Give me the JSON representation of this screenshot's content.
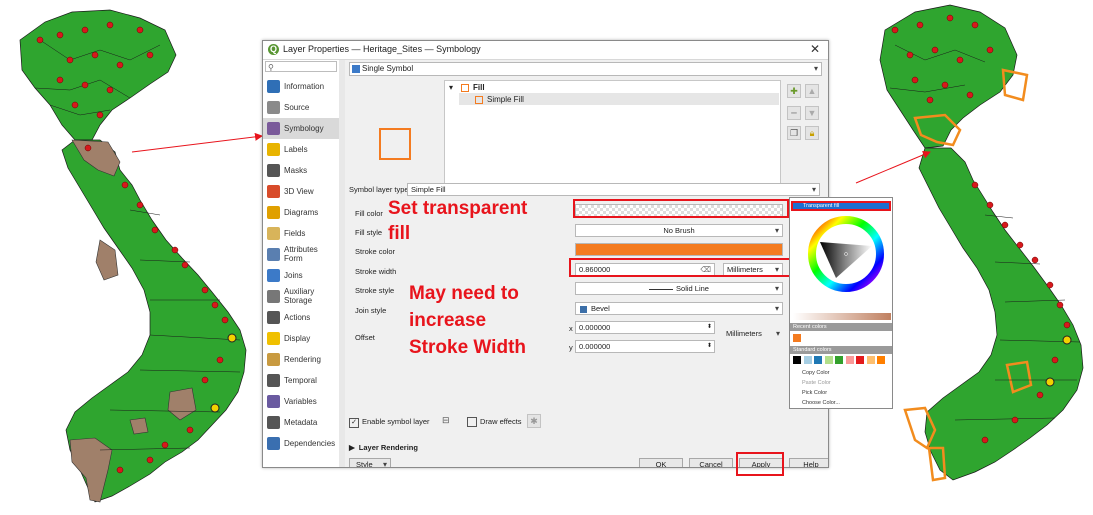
{
  "window": {
    "title": "Layer Properties — Heritage_Sites — Symbology",
    "app_icon": "qgis-icon",
    "close_glyph": "✕"
  },
  "sidebar": {
    "search_placeholder": "",
    "items": [
      {
        "label": "Information",
        "icon": "information-icon",
        "color": "#2f6fb6"
      },
      {
        "label": "Source",
        "icon": "source-icon",
        "color": "#8a8a8a"
      },
      {
        "label": "Symbology",
        "icon": "symbology-icon",
        "color": "#7a5a9a"
      },
      {
        "label": "Labels",
        "icon": "labels-icon",
        "color": "#e8b400"
      },
      {
        "label": "Masks",
        "icon": "masks-icon",
        "color": "#555555"
      },
      {
        "label": "3D View",
        "icon": "3d-view-icon",
        "color": "#d84b2a"
      },
      {
        "label": "Diagrams",
        "icon": "diagrams-icon",
        "color": "#e0a000"
      },
      {
        "label": "Fields",
        "icon": "fields-icon",
        "color": "#d8b45a"
      },
      {
        "label": "Attributes Form",
        "icon": "attributes-form-icon",
        "color": "#5a7fb0"
      },
      {
        "label": "Joins",
        "icon": "joins-icon",
        "color": "#3c7ac8"
      },
      {
        "label": "Auxiliary Storage",
        "icon": "auxiliary-storage-icon",
        "color": "#777777"
      },
      {
        "label": "Actions",
        "icon": "actions-icon",
        "color": "#555555"
      },
      {
        "label": "Display",
        "icon": "display-icon",
        "color": "#f0c000"
      },
      {
        "label": "Rendering",
        "icon": "rendering-icon",
        "color": "#c89a40"
      },
      {
        "label": "Temporal",
        "icon": "temporal-icon",
        "color": "#555555"
      },
      {
        "label": "Variables",
        "icon": "variables-icon",
        "color": "#6a5aa0"
      },
      {
        "label": "Metadata",
        "icon": "metadata-icon",
        "color": "#555555"
      },
      {
        "label": "Dependencies",
        "icon": "dependencies-icon",
        "color": "#3a6fb0"
      }
    ],
    "selected": "Symbology"
  },
  "renderer": {
    "value": "Single Symbol",
    "icon": "single-symbol-icon"
  },
  "symbol_tree": {
    "root": "Fill",
    "child": "Simple Fill",
    "expand_glyph": "▾"
  },
  "symbol_layer_type": {
    "label": "Symbol layer type",
    "value": "Simple Fill"
  },
  "properties": {
    "fill_color": {
      "label": "Fill color",
      "value": ""
    },
    "fill_style": {
      "label": "Fill style",
      "value": "No Brush"
    },
    "stroke_color": {
      "label": "Stroke color",
      "color": "#f47b20"
    },
    "stroke_width": {
      "label": "Stroke width",
      "value": "0.860000",
      "unit": "Millimeters"
    },
    "stroke_style": {
      "label": "Stroke style",
      "value": "Solid Line"
    },
    "join_style": {
      "label": "Join style",
      "value": "Bevel"
    },
    "offset": {
      "label": "Offset",
      "x_label": "x",
      "x": "0.000000",
      "y_label": "y",
      "y": "0.000000",
      "unit": "Millimeters"
    }
  },
  "checkboxes": {
    "enable_symbol_layer": {
      "label": "Enable symbol layer",
      "checked": true
    },
    "draw_effects": {
      "label": "Draw effects",
      "checked": false
    }
  },
  "layer_rendering": {
    "label": "Layer Rendering",
    "glyph": "▶"
  },
  "footer": {
    "style_button": "Style",
    "ok": "OK",
    "cancel": "Cancel",
    "apply": "Apply",
    "help": "Help"
  },
  "color_picker": {
    "transparent_fill": "Transparent fill",
    "recent_colors": "Recent colors",
    "standard_colors": "Standard colors",
    "menu": [
      "Copy Color",
      "Paste Color",
      "Pick Color",
      "Choose Color..."
    ],
    "swatches": [
      "#000000",
      "#a6cee3",
      "#1f78b4",
      "#b2df8a",
      "#33a02c",
      "#fb9a99",
      "#e31a1c",
      "#fdbf6f",
      "#ff7f00"
    ],
    "recent": "#f47b20"
  },
  "annotations": {
    "fill": [
      "Set transparent",
      "fill"
    ],
    "stroke": [
      "May need to",
      "increase",
      "Stroke Width"
    ],
    "color": "#e8141c"
  },
  "colors": {
    "map_fill": "#2fa52f",
    "map_highlight": "#a0806a",
    "orange": "#f28c1e",
    "point": "#d7191c"
  }
}
